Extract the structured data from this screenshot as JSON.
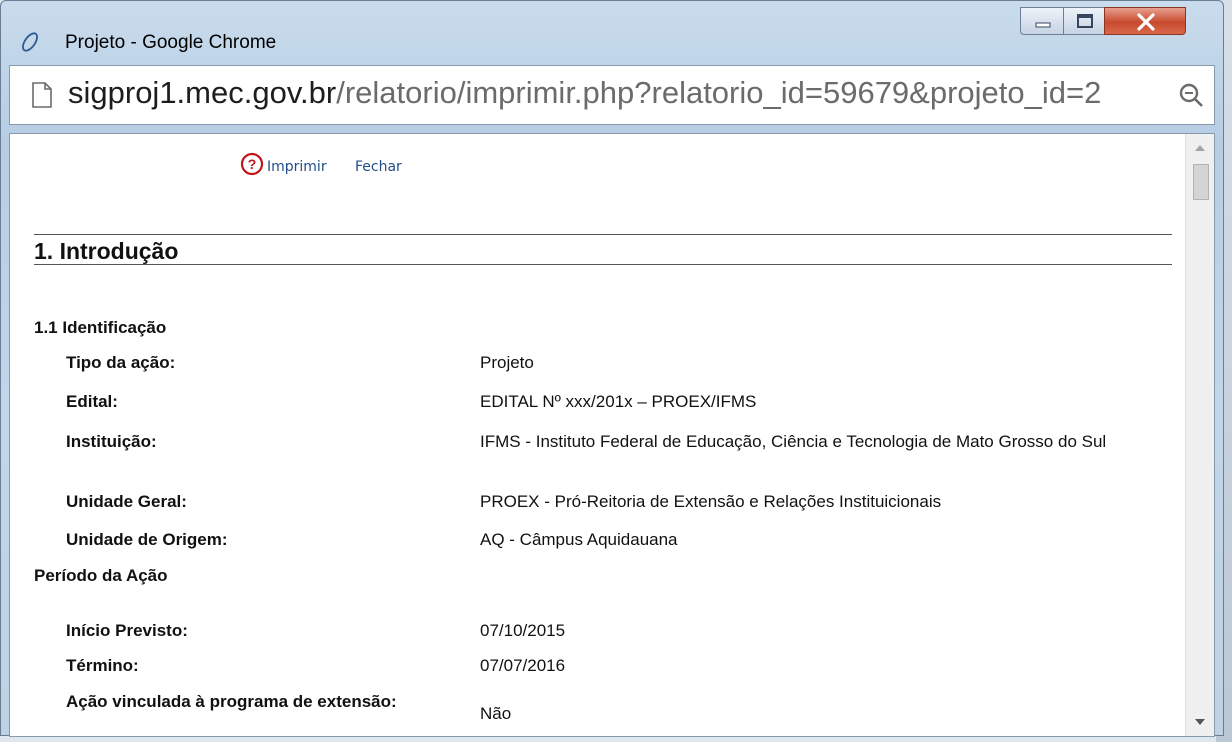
{
  "window": {
    "title": "Projeto - Google Chrome"
  },
  "address": {
    "host": "sigproj1.mec.gov.br",
    "path": "/relatorio/imprimir.php?relatorio_id=59679&projeto_id=2"
  },
  "toolbar": {
    "print_label": "Imprimir",
    "close_label": "Fechar"
  },
  "report": {
    "section_title": "1. Introdução",
    "subsection_title": "1.1 Identificação",
    "fields": [
      {
        "label": "Tipo da ação:",
        "value": "Projeto"
      },
      {
        "label": "Edital:",
        "value": "EDITAL Nº xxx/201x – PROEX/IFMS"
      },
      {
        "label": "Instituição:",
        "value": "IFMS - Instituto Federal de Educação, Ciência e Tecnologia de Mato Grosso do Sul"
      },
      {
        "label": "Unidade Geral:",
        "value": "PROEX - Pró-Reitoria de Extensão e Relações Instituicionais"
      },
      {
        "label": "Unidade de Origem:",
        "value": "AQ - Câmpus Aquidauana"
      }
    ],
    "period_title": "Período da Ação",
    "period_fields": [
      {
        "label": "Início Previsto:",
        "value": "07/10/2015"
      },
      {
        "label": "Término:",
        "value": "07/07/2016"
      },
      {
        "label": "Ação vinculada à programa de extensão:",
        "value": "Não"
      }
    ]
  },
  "icons": {
    "app": "chrome-logo-icon",
    "page": "page-icon",
    "zoom": "zoom-icon",
    "help": "help-icon"
  },
  "colors": {
    "link": "#1f4e8c",
    "help_icon": "#c0161c",
    "close_button": "#c74a2d"
  }
}
